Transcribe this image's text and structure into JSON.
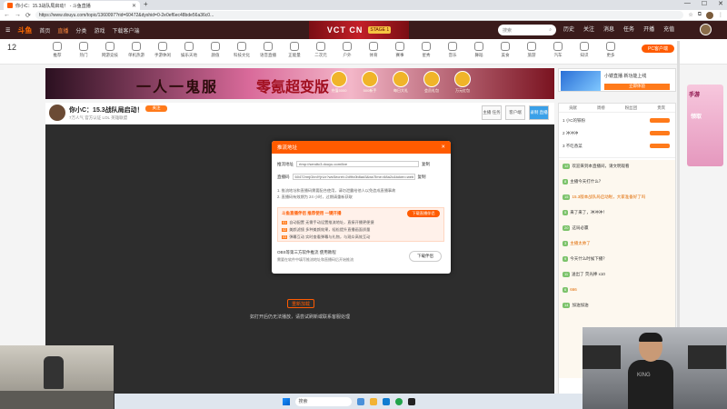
{
  "browser": {
    "tab_title": "你小C：15.3战队局启动！ - 斗鱼直播",
    "new_tab": "+",
    "window_controls": [
      "—",
      "☐",
      "✕"
    ],
    "url": "https://www.douyu.com/topic/1360097?rid=60472&dyshid=0-2e0ef6ec48bde56a36c0...",
    "nav": [
      "←",
      "→",
      "⟳"
    ]
  },
  "header": {
    "logo": "斗鱼",
    "links": [
      "首页",
      "直播",
      "分类",
      "游戏",
      "下载客户端"
    ],
    "active_index": 1,
    "vct": {
      "title": "VCT CN",
      "tag": "STAGE 1"
    },
    "search_placeholder": "搜索",
    "icons": [
      "历史",
      "关注",
      "消息",
      "任务",
      "开播",
      "充值"
    ]
  },
  "categories": [
    "推荐",
    "热门",
    "网游竞技",
    "单机热游",
    "手游休闲",
    "娱乐天地",
    "颜值",
    "科技文化",
    "语音直播",
    "正能量",
    "二次元",
    "户外",
    "体育",
    "赛事",
    "星秀",
    "音乐",
    "舞蹈",
    "美食",
    "旅游",
    "汽车",
    "知识",
    "更多"
  ],
  "left_counter": "12",
  "pc_button": "PC客户端",
  "banner": {
    "text1": "一人一鬼服",
    "text2": "零氪超变版",
    "prizes": [
      "充值5000",
      "500新手",
      "每日大礼",
      "会员礼包",
      "万元红包"
    ]
  },
  "ad": {
    "title": "小镜直播 新功能上线",
    "button": "立即体验"
  },
  "room": {
    "title": "你小C：15.3战队局启动！",
    "follow": "关注",
    "meta": "7万人气   官方认证   LOL   英雄联盟",
    "buttons": [
      "主播\n任务",
      "客户端",
      "录制\n直播"
    ]
  },
  "player": {
    "retry": "重新加载",
    "hint": "如打开后仍无法播放，请尝试刷新或联系客服处理"
  },
  "modal": {
    "title": "推流地址",
    "rtmp_label": "推流地址",
    "rtmp_value": "rtmp://sendtc3.douyu.com/live",
    "rtmp_copy": "复制",
    "key_label": "直播码",
    "key_value": "60472rmjGbnlYjrUx?wsSecret=2d9fc0b8ad3&wsTime=68a2c&token=web",
    "key_copy": "复制",
    "note1": "1. 推流地址和直播码需要配合使用，请勿泄露给他人以免造成直播事故",
    "note2": "2. 直播码有效期为 24 小时，过期请重新获取",
    "box_title": "斗鱼直播伴侣  推荐使用  一键开播",
    "box_button": "下载直播伴侣",
    "box_items": [
      "自动配置  无需手动设置推流地址，直接开播更便捷",
      "美颜滤镜  多种美颜效果，轻松提升直播画面质量",
      "弹幕互动  实时查看弹幕与礼物，与观众高效互动"
    ],
    "foot1": "OBS等第三方软件推流  使用教程",
    "foot2": "需要在软件中填写推流地址和直播码后开始推流",
    "download": "下载伴侣"
  },
  "sidebar": {
    "tabs": [
      "贡献",
      "周榜",
      "粉丝团",
      "贵宾"
    ],
    "ranks": [
      "1  小C的铁粉",
      "2  冲冲冲",
      "3  不吃香菜"
    ],
    "messages": [
      {
        "badge": "12",
        "text": "欢迎来到本直播间，请文明观看"
      },
      {
        "badge": "8",
        "text": "主播今天打什么？"
      },
      {
        "badge": "15",
        "text": "15.3版本战队局启动啦，大家准备好了吗"
      },
      {
        "badge": "5",
        "text": "来了来了，冲冲冲！"
      },
      {
        "badge": "20",
        "text": "这局必赢"
      },
      {
        "badge": "3",
        "text": "主播太帅了"
      },
      {
        "badge": "9",
        "text": "今天什么时候下播？"
      },
      {
        "badge": "11",
        "text": "送出了 荧光棒 x10"
      },
      {
        "badge": "6",
        "text": "666"
      },
      {
        "badge": "14",
        "text": "加油加油"
      }
    ]
  },
  "far_right": {
    "title": "手游",
    "label": "领取"
  },
  "webcam": {
    "shirt_text": "KING"
  },
  "taskbar": {
    "search": "搜索"
  }
}
